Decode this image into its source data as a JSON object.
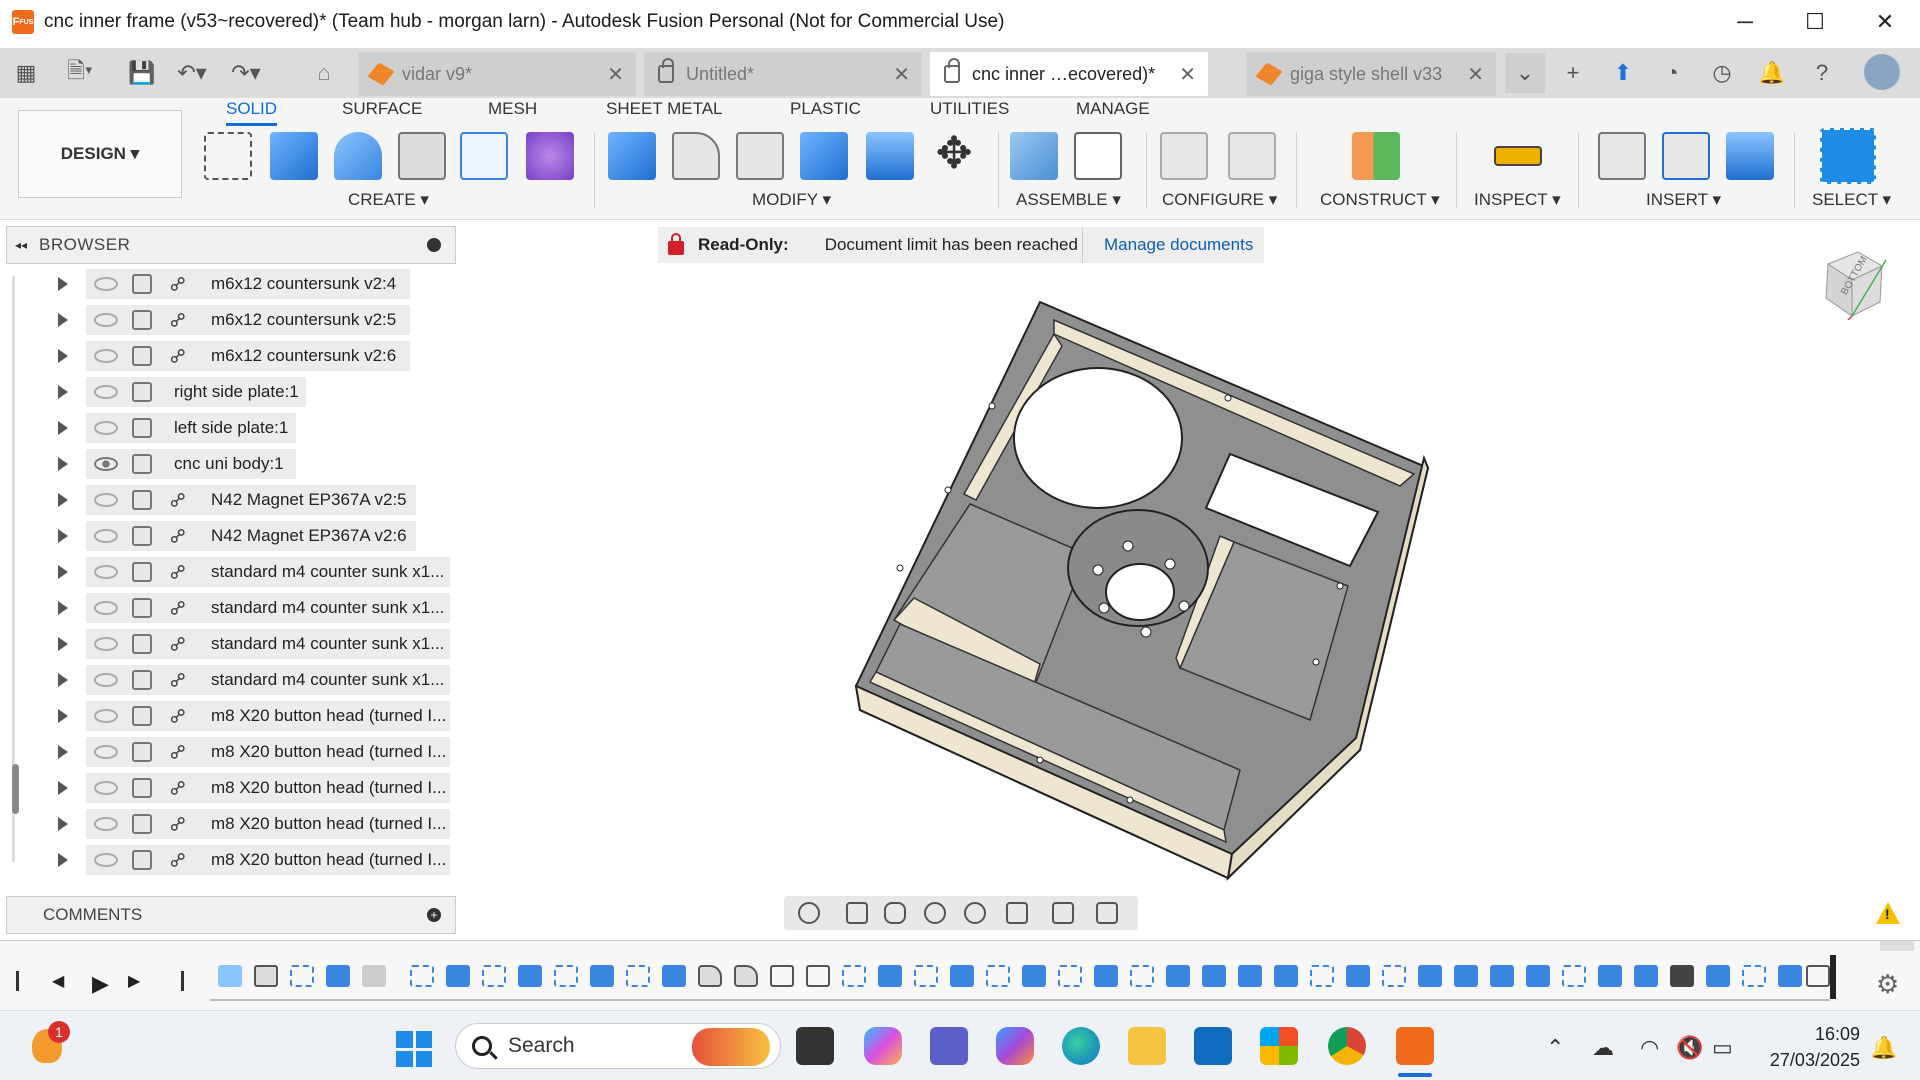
{
  "window": {
    "title": "cnc inner frame (v53~recovered)* (Team hub - morgan larn) - Autodesk Fusion Personal (Not for Commercial Use)",
    "app_badge": "F FUS",
    "minimize": "─",
    "maximize": "☐",
    "close": "✕"
  },
  "tabs": [
    {
      "label": "vidar v9*",
      "icon": "cube-icon",
      "active": false
    },
    {
      "label": "Untitled*",
      "icon": "lock-icon",
      "active": false
    },
    {
      "label": "cnc inner …ecovered)*",
      "icon": "lock-icon",
      "active": true
    },
    {
      "label": "giga style shell v33",
      "icon": "cube-icon",
      "active": false
    }
  ],
  "workspace_tabs": [
    "SOLID",
    "SURFACE",
    "MESH",
    "SHEET METAL",
    "PLASTIC",
    "UTILITIES",
    "MANAGE"
  ],
  "design_button": "DESIGN ▾",
  "groups": {
    "create": "CREATE ▾",
    "modify": "MODIFY ▾",
    "assemble": "ASSEMBLE ▾",
    "configure": "CONFIGURE ▾",
    "construct": "CONSTRUCT ▾",
    "inspect": "INSPECT ▾",
    "insert": "INSERT ▾",
    "select": "SELECT ▾"
  },
  "browser": {
    "title": "BROWSER",
    "collapse": "◂◂",
    "items": [
      {
        "label": "m6x12 countersunk v2:4",
        "visible": false,
        "linked": true
      },
      {
        "label": "m6x12 countersunk v2:5",
        "visible": false,
        "linked": true
      },
      {
        "label": "m6x12 countersunk v2:6",
        "visible": false,
        "linked": true
      },
      {
        "label": "right side plate:1",
        "visible": false,
        "linked": false
      },
      {
        "label": "left side plate:1",
        "visible": false,
        "linked": false
      },
      {
        "label": "cnc uni body:1",
        "visible": true,
        "linked": false
      },
      {
        "label": "N42 Magnet EP367A v2:5",
        "visible": false,
        "linked": true
      },
      {
        "label": "N42 Magnet EP367A v2:6",
        "visible": false,
        "linked": true
      },
      {
        "label": "standard m4 counter sunk x1...",
        "visible": false,
        "linked": true
      },
      {
        "label": "standard m4 counter sunk x1...",
        "visible": false,
        "linked": true
      },
      {
        "label": "standard m4 counter sunk x1...",
        "visible": false,
        "linked": true
      },
      {
        "label": "standard m4 counter sunk x1...",
        "visible": false,
        "linked": true
      },
      {
        "label": "m8 X20 button head (turned I...",
        "visible": false,
        "linked": true
      },
      {
        "label": "m8 X20 button head (turned I...",
        "visible": false,
        "linked": true
      },
      {
        "label": "m8 X20 button head (turned I...",
        "visible": false,
        "linked": true
      },
      {
        "label": "m8 X20 button head (turned I...",
        "visible": false,
        "linked": true
      },
      {
        "label": "m8 X20 button head (turned I...",
        "visible": false,
        "linked": true
      }
    ]
  },
  "comments": {
    "title": "COMMENTS"
  },
  "banner": {
    "status": "Read-Only:",
    "message": "Document limit has been reached",
    "action": "Manage documents"
  },
  "viewcube": {
    "face": "BOTTOM"
  },
  "taskbar": {
    "search_placeholder": "Search",
    "time": "16:09",
    "date": "27/03/2025",
    "notification_count": "1"
  },
  "colors": {
    "accent": "#0a6fd6",
    "readonly_red": "#d0202a",
    "fusion_orange": "#f26b1d",
    "model_face": "#8f8f8f",
    "model_wall": "#efe6d2"
  }
}
